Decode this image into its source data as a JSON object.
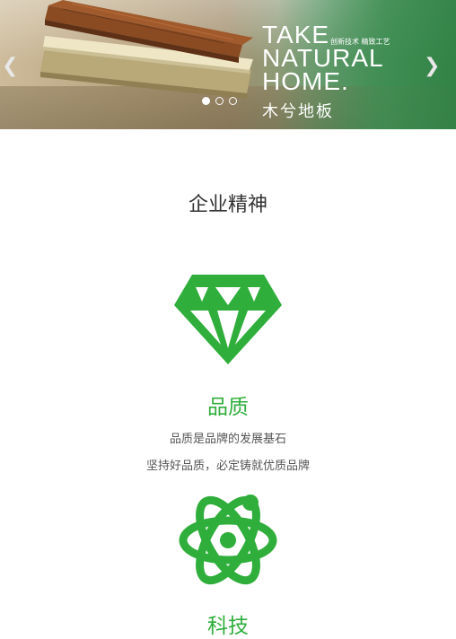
{
  "colors": {
    "accent": "#2fae3b",
    "text": "#333333"
  },
  "banner": {
    "headline": [
      "TAKE",
      "NATURAL",
      "HOME."
    ],
    "tagline": "创新技术 精致工艺",
    "brand": "木兮地板",
    "prev_icon": "chevron-left-icon",
    "next_icon": "chevron-right-icon",
    "active_slide": 1,
    "slide_count": 3
  },
  "section": {
    "title": "企业精神",
    "features": [
      {
        "icon": "diamond-icon",
        "name": "品质",
        "lines": [
          "品质是品牌的发展基石",
          "坚持好品质，必定铸就优质品牌"
        ]
      },
      {
        "icon": "atom-icon",
        "name": "科技"
      }
    ]
  }
}
